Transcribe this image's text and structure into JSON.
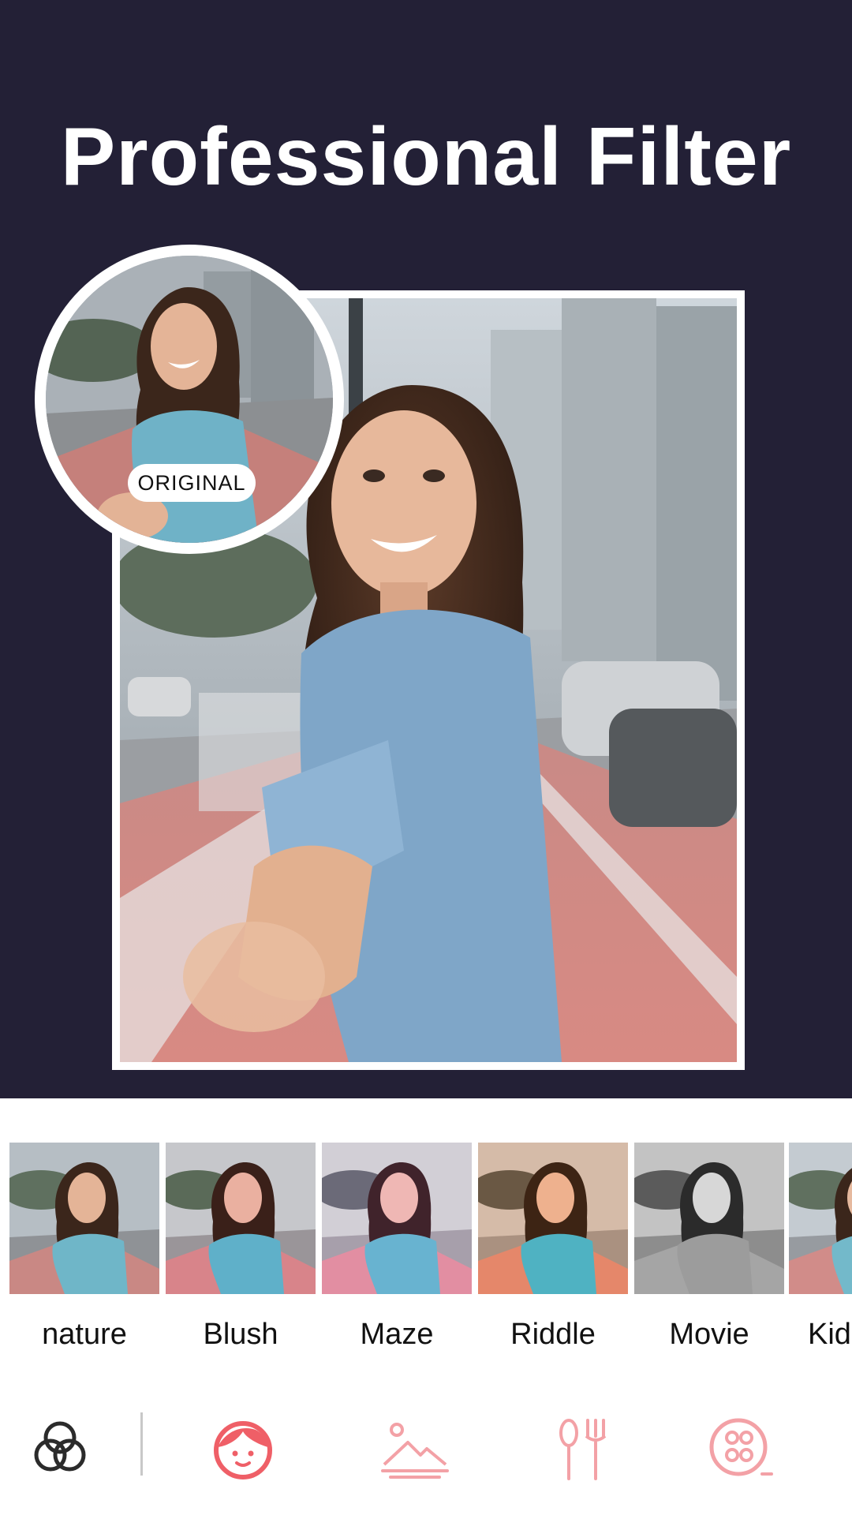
{
  "headline": "Professional Filter",
  "original_badge": "ORIGINAL",
  "filters": [
    {
      "label": "nature",
      "tone": "natural"
    },
    {
      "label": "Blush",
      "tone": "warm"
    },
    {
      "label": "Maze",
      "tone": "pink"
    },
    {
      "label": "Riddle",
      "tone": "orange"
    },
    {
      "label": "Movie",
      "tone": "mono"
    },
    {
      "label": "Kid",
      "tone": "cool"
    }
  ],
  "toolbar": {
    "items": [
      {
        "name": "filters-tool",
        "icon": "overlapping-circles-icon"
      },
      {
        "name": "face-tool",
        "icon": "face-icon"
      },
      {
        "name": "scenery-tool",
        "icon": "landscape-icon"
      },
      {
        "name": "food-tool",
        "icon": "fork-knife-icon"
      },
      {
        "name": "film-tool",
        "icon": "film-reel-icon"
      }
    ]
  },
  "colors": {
    "hero_background": "#232036",
    "accent": "#ef5f67",
    "accent_light": "#f3a1a6"
  }
}
